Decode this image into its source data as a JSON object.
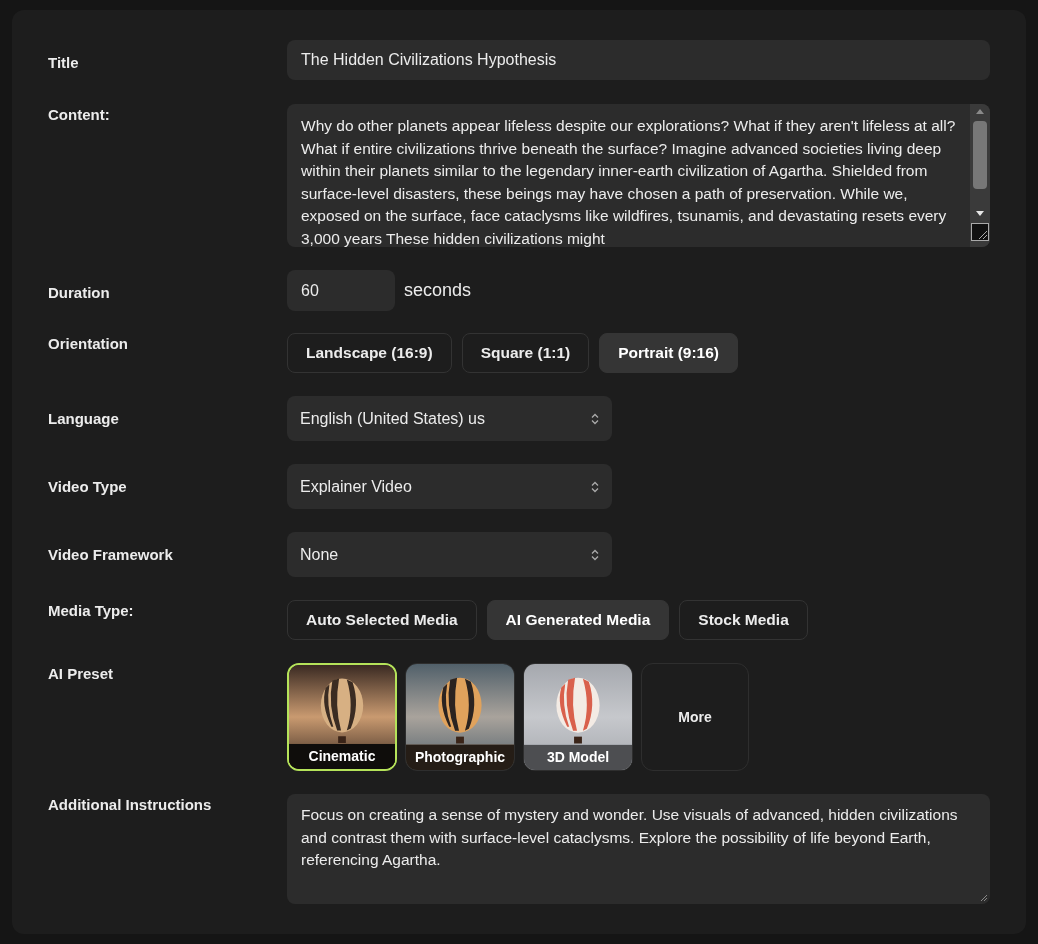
{
  "title": {
    "label": "Title",
    "value": "The Hidden Civilizations Hypothesis"
  },
  "content": {
    "label": "Content:",
    "value": "Why do other planets appear lifeless despite our explorations? What if they aren't lifeless at all? What if entire civilizations thrive beneath the surface? Imagine advanced societies living deep within their planets similar to the legendary inner-earth civilization of Agartha. Shielded from surface-level disasters, these beings may have chosen a path of preservation. While we, exposed on the surface, face cataclysms like wildfires, tsunamis, and devastating resets every 3,000 years These hidden civilizations might"
  },
  "duration": {
    "label": "Duration",
    "value": "60",
    "unit": "seconds"
  },
  "orientation": {
    "label": "Orientation",
    "options": [
      {
        "label": "Landscape (16:9)",
        "selected": false
      },
      {
        "label": "Square (1:1)",
        "selected": false
      },
      {
        "label": "Portrait (9:16)",
        "selected": true
      }
    ]
  },
  "selects": [
    {
      "label": "Language",
      "value": "English (United States) us"
    },
    {
      "label": "Video Type",
      "value": "Explainer Video"
    },
    {
      "label": "Video Framework",
      "value": "None"
    }
  ],
  "media_type": {
    "label": "Media Type:",
    "options": [
      {
        "label": "Auto Selected Media",
        "selected": false
      },
      {
        "label": "AI Generated Media",
        "selected": true
      },
      {
        "label": "Stock Media",
        "selected": false
      }
    ]
  },
  "ai_preset": {
    "label": "AI Preset",
    "options": [
      {
        "kind": "picture",
        "label": "Cinematic",
        "selected": true
      },
      {
        "kind": "picture",
        "label": "Photographic",
        "selected": false
      },
      {
        "kind": "picture",
        "label": "3D Model",
        "selected": false
      },
      {
        "kind": "more",
        "label": "More",
        "selected": false
      }
    ]
  },
  "additional_instructions": {
    "label": "Additional Instructions",
    "value": "Focus on creating a sense of mystery and wonder. Use visuals of advanced, hidden civilizations and contrast them with surface-level cataclysms. Explore the possibility of life beyond Earth, referencing Agartha."
  }
}
